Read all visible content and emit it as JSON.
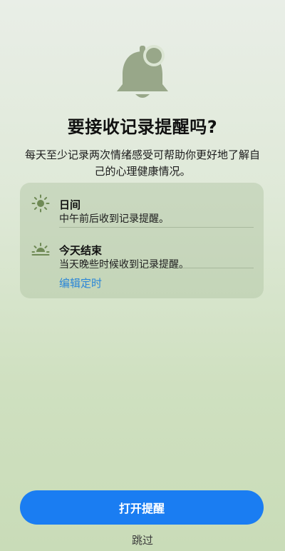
{
  "header": {
    "title": "要接收记录提醒吗?",
    "subtitle": "每天至少记录两次情绪感受可帮助你更好地了解自己的心理健康情况。"
  },
  "options": [
    {
      "icon": "sun-icon",
      "title": "日间",
      "description": "中午前后收到记录提醒。"
    },
    {
      "icon": "sunset-icon",
      "title": "今天结束",
      "description": "当天晚些时候收到记录提醒。"
    }
  ],
  "edit_label": "编辑定时",
  "primary_button": "打开提醒",
  "skip_label": "跳过",
  "colors": {
    "accent": "#1a7df2",
    "link": "#2a86d8",
    "icon": "#6f8a55",
    "bell": "#98a789"
  }
}
